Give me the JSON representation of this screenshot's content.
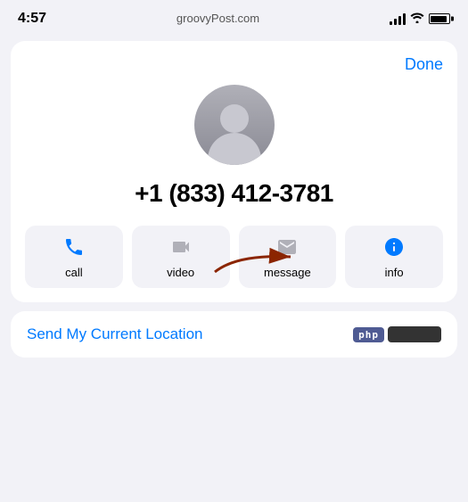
{
  "statusBar": {
    "time": "4:57",
    "domain": "groovyPost.com"
  },
  "header": {
    "done_label": "Done"
  },
  "contact": {
    "phone_number": "+1 (833) 412-3781"
  },
  "actions": [
    {
      "id": "call",
      "label": "call",
      "icon": "phone",
      "enabled": true
    },
    {
      "id": "video",
      "label": "video",
      "icon": "video",
      "enabled": false
    },
    {
      "id": "message",
      "label": "message",
      "icon": "message",
      "enabled": false
    },
    {
      "id": "info",
      "label": "info",
      "icon": "info",
      "enabled": true
    }
  ],
  "bottom": {
    "send_location_label": "Send My Current Location"
  }
}
